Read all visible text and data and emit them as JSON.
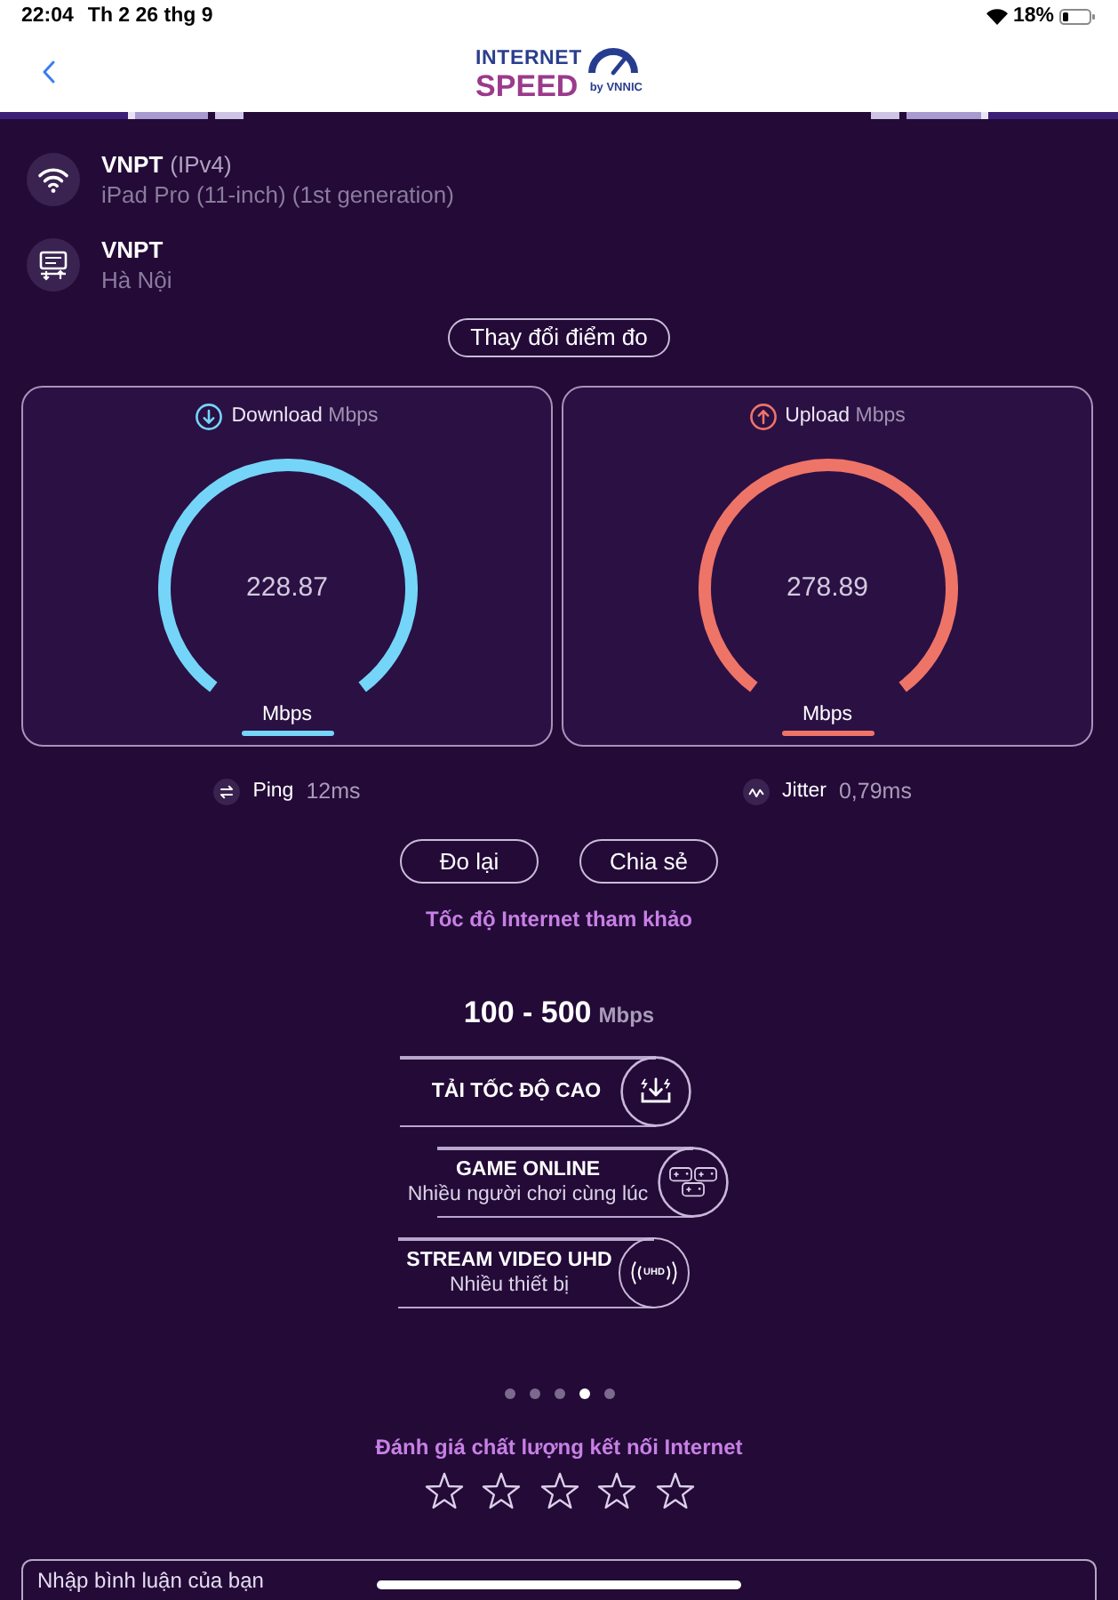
{
  "status_bar": {
    "time": "22:04",
    "date": "Th 2 26 thg 9",
    "battery": "18%"
  },
  "header": {
    "logo": {
      "line_1": "INTERNET",
      "line_2": "SPEED",
      "tagline": "by VNNIC"
    }
  },
  "connection": [
    {
      "kind": "wifi",
      "name": "VNPT",
      "detail": "(IPv4)",
      "subtitle": "iPad Pro (11-inch) (1st generation)"
    },
    {
      "kind": "server",
      "name": "VNPT",
      "subtitle": "Hà Nội"
    }
  ],
  "change_server_button": "Thay đổi điểm đo",
  "gauges": [
    {
      "kind": "download",
      "label": "Download",
      "unit_label": "Mbps",
      "value": "228.87",
      "unit": "Mbps",
      "color": "#74d5f8"
    },
    {
      "kind": "upload",
      "label": "Upload",
      "unit_label": "Mbps",
      "value": "278.89",
      "unit": "Mbps",
      "color": "#ee7468"
    }
  ],
  "metrics": [
    {
      "kind": "ping",
      "label": "Ping",
      "value": "12ms"
    },
    {
      "kind": "jitter",
      "label": "Jitter",
      "value": "0,79ms"
    }
  ],
  "actions": [
    "Đo lại",
    "Chia sẻ"
  ],
  "reference": {
    "title": "Tốc độ Internet tham khảo",
    "range": "100 - 500",
    "unit": "Mbps",
    "items": [
      {
        "kind": "download",
        "title": "TẢI TỐC ĐỘ CAO"
      },
      {
        "kind": "gaming",
        "title": "GAME ONLINE",
        "subtitle": "Nhiều người chơi cùng lúc"
      },
      {
        "kind": "streaming",
        "title": "STREAM VIDEO UHD",
        "subtitle": "Nhiều thiết bị",
        "badge": "UHD"
      }
    ],
    "pages": [
      {
        "selected": false
      },
      {
        "selected": false
      },
      {
        "selected": false
      },
      {
        "selected": true
      },
      {
        "selected": false
      }
    ]
  },
  "rating": {
    "title": "Đánh giá chất lượng kết nối Internet",
    "stars": 0
  },
  "comment": {
    "placeholder": "Nhập bình luận của bạn"
  }
}
